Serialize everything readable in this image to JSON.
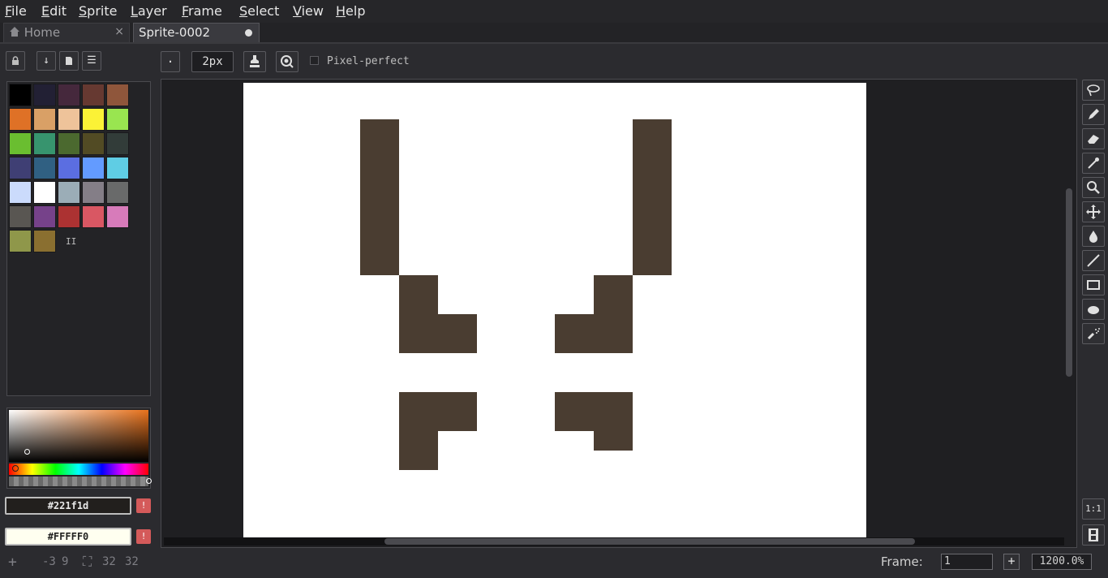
{
  "menu": [
    "File",
    "Edit",
    "Sprite",
    "Layer",
    "Frame",
    "Select",
    "View",
    "Help"
  ],
  "tabs": [
    {
      "label": "Home",
      "icon": "home-icon",
      "close": "×"
    },
    {
      "label": "Sprite-0002",
      "modified": true
    }
  ],
  "layer_buttons": {
    "lock": "lock-icon",
    "down": "↓",
    "new": "▆",
    "menu": "☰"
  },
  "palette": {
    "colors": [
      "#000000",
      "#222034",
      "#45283c",
      "#663931",
      "#8f563b",
      "#df7126",
      "#d9a066",
      "#eec39a",
      "#fbf236",
      "#99e550",
      "#6abe30",
      "#37946e",
      "#4b692f",
      "#524b24",
      "#323c39",
      "#3f3f74",
      "#306082",
      "#5b6ee1",
      "#639bff",
      "#5fcde4",
      "#cbdbfc",
      "#ffffff",
      "#9badb7",
      "#847e87",
      "#696a6a",
      "#595652",
      "#76428a",
      "#ac3232",
      "#d95763",
      "#d77bba",
      "#8f974a",
      "#8a6f30"
    ],
    "pause_glyph": "II"
  },
  "colors": {
    "foreground_hex": "#221f1d",
    "background_hex": "#FFFFF0",
    "foreground_swatch": "#221f1d",
    "background_swatch": "#fffff0",
    "warn_glyph": "!"
  },
  "tool_options": {
    "brush_shape": "·",
    "brush_size": "2px",
    "pixel_perfect_label": "Pixel-perfect",
    "pixel_perfect_checked": false
  },
  "tools": [
    "lasso-icon",
    "pencil-icon",
    "eraser-icon",
    "eyedropper-icon",
    "zoom-icon",
    "move-icon",
    "fill-icon",
    "line-icon",
    "rectangle-icon",
    "ellipse-icon",
    "spray-icon"
  ],
  "bottom_tools": {
    "actual_size": "1:1",
    "timeline": "filmstrip-icon"
  },
  "status": {
    "cursor_icon": "+",
    "cursor_x": "-3",
    "cursor_y": "9",
    "size_icon": "⛶",
    "width": "32",
    "height": "32",
    "frame_label": "Frame:",
    "frame_value": "1",
    "add_frame": "+",
    "zoom": "1200.0%"
  }
}
